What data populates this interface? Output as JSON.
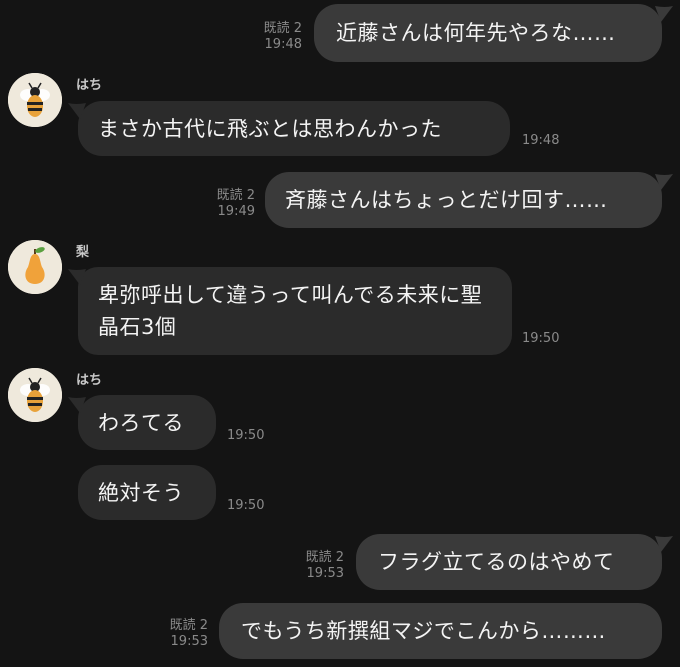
{
  "messages": [
    {
      "side": "out",
      "text": "近藤さんは何年先やろな……",
      "read": "既読 2",
      "time": "19:48"
    },
    {
      "side": "in",
      "sender": "はち",
      "avatar": "bee-icon",
      "text": "まさか古代に飛ぶとは思わんかった",
      "time": "19:48"
    },
    {
      "side": "out",
      "text": "斉藤さんはちょっとだけ回す……",
      "read": "既読 2",
      "time": "19:49"
    },
    {
      "side": "in",
      "sender": "梨",
      "avatar": "pear-icon",
      "text": "卑弥呼出して違うって叫んでる未来に聖晶石3個",
      "time": "19:50"
    },
    {
      "side": "in",
      "sender": "はち",
      "avatar": "bee-icon",
      "text": "わろてる",
      "time": "19:50"
    },
    {
      "side": "in",
      "text": "絶対そう",
      "time": "19:50"
    },
    {
      "side": "out",
      "text": "フラグ立てるのはやめて",
      "read": "既読 2",
      "time": "19:53"
    },
    {
      "side": "out",
      "text": "でもうち新撰組マジでこんから………",
      "read": "既読 2",
      "time": "19:53"
    }
  ],
  "colors": {
    "background": "#141414",
    "bubble_in": "#2b2b2b",
    "bubble_out": "#3a3a3a",
    "meta_text": "#8a8a8a"
  }
}
